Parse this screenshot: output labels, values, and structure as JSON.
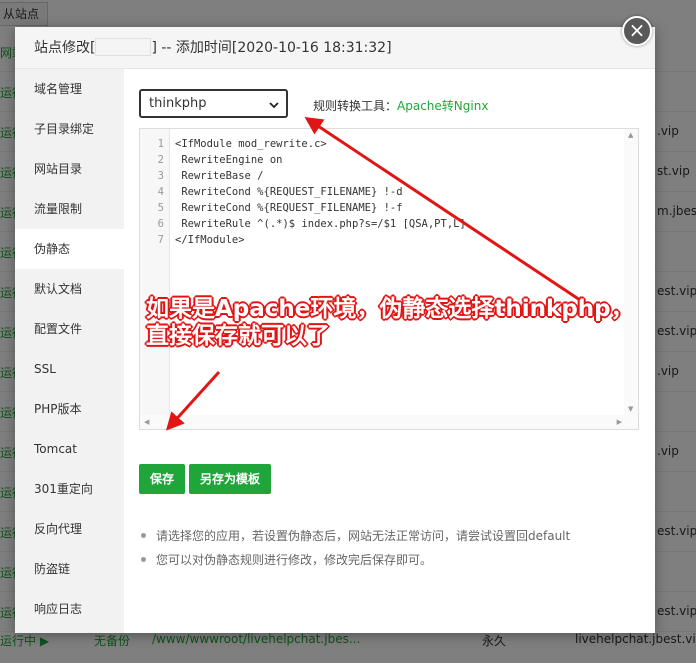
{
  "background": {
    "top_button": "从站点",
    "row_left_texts": [
      "网站",
      "运行",
      "运行",
      "运行",
      "运行",
      "运行",
      "运行",
      "运行",
      "运行",
      "运行",
      "运行",
      "运行",
      "运行",
      "运行",
      "运行"
    ],
    "row_right_texts": [
      "",
      "",
      ".vip",
      "st.vip",
      "m.jbest.",
      "",
      "est.vip",
      "est.vip",
      ".vip",
      "",
      ".vip",
      "",
      "est.vip",
      "",
      "est.vip"
    ],
    "last_row": {
      "status": "运行中 ▶",
      "backup": "无备份",
      "path": "/www/wwwroot/livehelpchat.jbes...",
      "expire": "永久",
      "domain": "livehelpchat.jbest.vip"
    }
  },
  "modal": {
    "title_prefix": "站点修改[",
    "title_suffix": "] -- 添加时间[2020-10-16 18:31:32]",
    "close_symbol": "×"
  },
  "sidebar": {
    "items": [
      "域名管理",
      "子目录绑定",
      "网站目录",
      "流量限制",
      "伪静态",
      "默认文档",
      "配置文件",
      "SSL",
      "PHP版本",
      "Tomcat",
      "301重定向",
      "反向代理",
      "防盗链",
      "响应日志"
    ]
  },
  "rewrite": {
    "selected_template": "thinkphp",
    "tool_label": "规则转换工具：",
    "tool_link": "Apache转Nginx",
    "code_lines": [
      {
        "n": "1",
        "text": "<IfModule mod_rewrite.c>"
      },
      {
        "n": "2",
        "text": " RewriteEngine on"
      },
      {
        "n": "3",
        "text": " RewriteBase /"
      },
      {
        "n": "4",
        "text": " RewriteCond %{REQUEST_FILENAME} !-d"
      },
      {
        "n": "5",
        "text": " RewriteCond %{REQUEST_FILENAME} !-f"
      },
      {
        "n": "6",
        "text": " RewriteRule ^(.*)$ index.php?s=/$1 [QSA,PT,L]"
      },
      {
        "n": "7",
        "text": "</IfModule>"
      }
    ],
    "save_button": "保存",
    "save_template_button": "另存为模板",
    "notes": [
      "请选择您的应用，若设置伪静态后，网站无法正常访问，请尝试设置回default",
      "您可以对伪静态规则进行修改，修改完后保存即可。"
    ]
  },
  "annotation": {
    "line1": "如果是Apache环境，伪静态选择thinkphp，",
    "line2": "直接保存就可以了",
    "color": "#e21515"
  },
  "colors": {
    "accent": "#20a53a",
    "sidebar_bg": "#f2f2f2",
    "arrow": "#e21515"
  }
}
